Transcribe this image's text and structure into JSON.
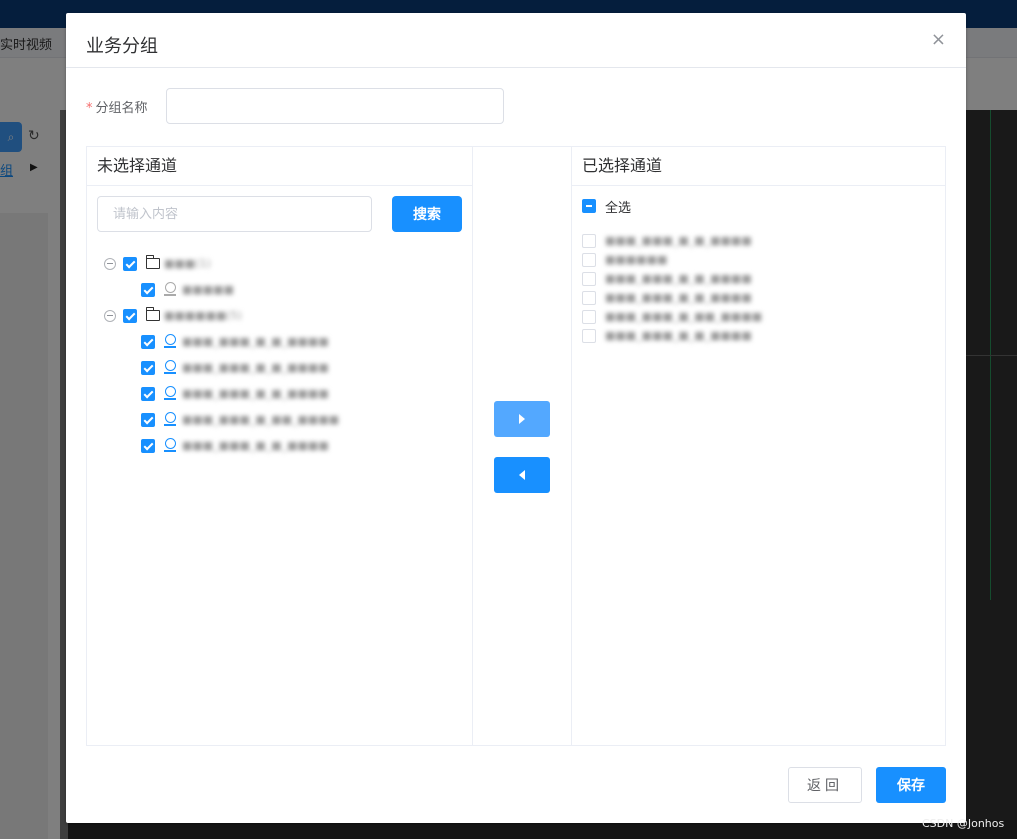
{
  "background": {
    "tab_label": "实时视频",
    "group_tab": "组",
    "search_icon": "search-icon",
    "refresh_icon": "refresh-icon"
  },
  "dialog": {
    "title": "业务分组",
    "close_icon": "×",
    "form": {
      "required_mark": "*",
      "group_name_label": "分组名称",
      "group_name_value": ""
    },
    "left_panel": {
      "title": "未选择通道",
      "search_placeholder": "请输入内容",
      "search_button": "搜索",
      "tree": [
        {
          "label": "■■■(1)",
          "checked": true,
          "children": [
            {
              "label": "■■■■■",
              "checked": true
            }
          ]
        },
        {
          "label": "■■■■■■(5)",
          "checked": true,
          "children": [
            {
              "label": "■■■_■■■_■_■_■■■■",
              "checked": true
            },
            {
              "label": "■■■_■■■_■_■_■■■■",
              "checked": true
            },
            {
              "label": "■■■_■■■_■_■_■■■■",
              "checked": true
            },
            {
              "label": "■■■_■■■_■_■■_■■■■",
              "checked": true
            },
            {
              "label": "■■■_■■■_■_■_■■■■",
              "checked": true
            }
          ]
        }
      ]
    },
    "right_panel": {
      "title": "已选择通道",
      "select_all": "全选",
      "items": [
        "■■■_■■■_■_■_■■■■",
        "■■■■■■",
        "■■■_■■■_■_■_■■■■",
        "■■■_■■■_■_■_■■■■",
        "■■■_■■■_■_■■_■■■■",
        "■■■_■■■_■_■_■■■■"
      ]
    },
    "buttons": {
      "back": "返回",
      "save": "保存"
    }
  },
  "watermark": "CSDN @Jonhos",
  "colors": {
    "primary": "#1890ff",
    "primary_light": "#53a8ff",
    "required": "#f56c6c"
  }
}
